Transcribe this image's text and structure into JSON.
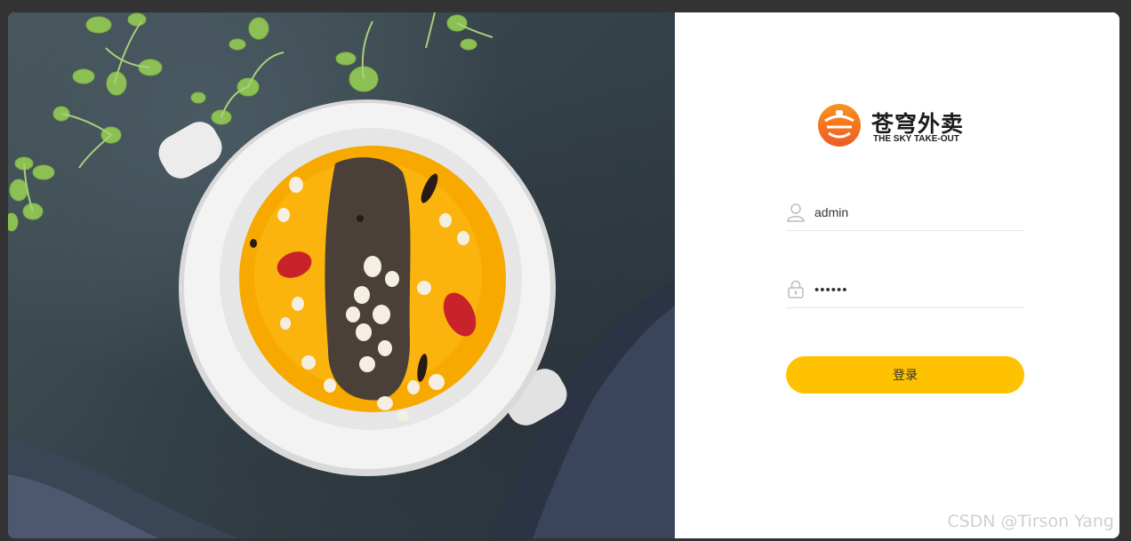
{
  "brand": {
    "name_cn": "苍穹外卖",
    "name_en": "THE SKY TAKE-OUT",
    "accent_color": "#ffc200",
    "logo_colors": [
      "#f7931e",
      "#ee5a24"
    ]
  },
  "login": {
    "username": {
      "value": "admin",
      "icon": "user-icon"
    },
    "password": {
      "value": "••••••",
      "icon": "lock-icon"
    },
    "submit_label": "登录"
  },
  "hero_image": {
    "subject": "food-photo"
  },
  "watermark": "CSDN @Tirson Yang"
}
